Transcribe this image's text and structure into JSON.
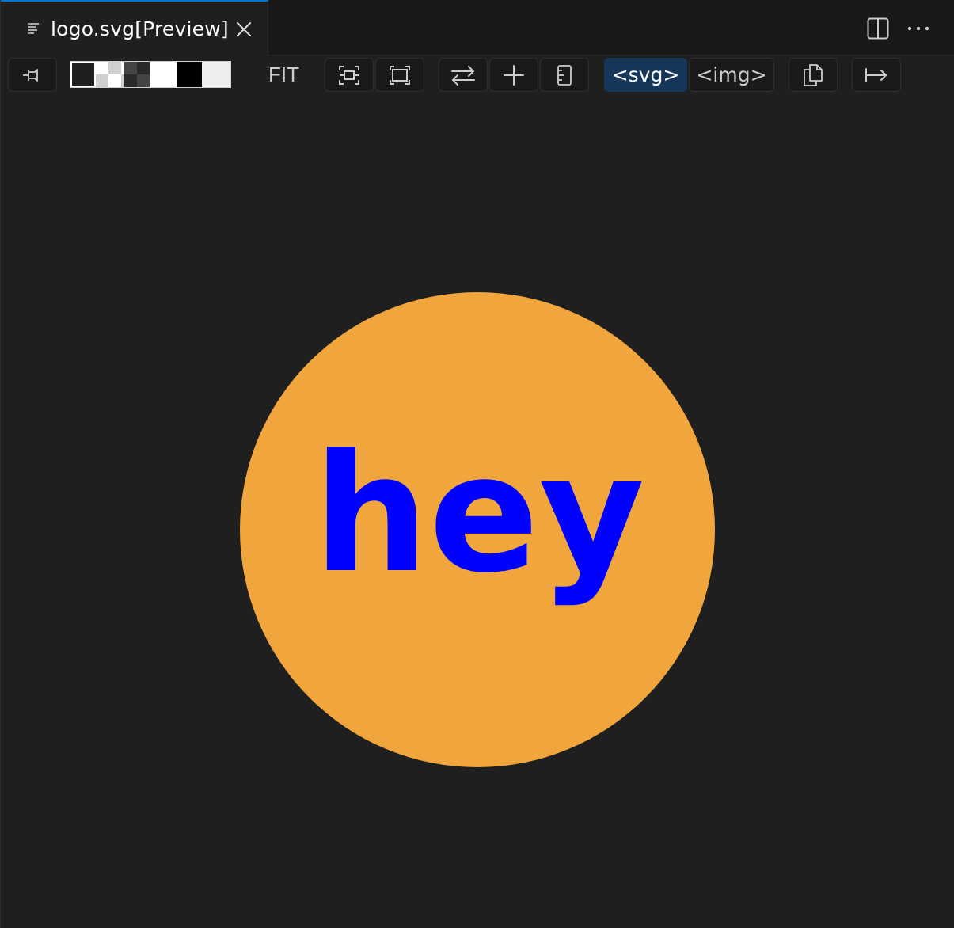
{
  "tab": {
    "title": "logo.svg[Preview]",
    "file_icon": "lines-icon",
    "close_icon": "close-icon"
  },
  "editor_actions": {
    "split_icon": "split-editor-icon",
    "more_icon": "ellipsis-icon"
  },
  "toolbar": {
    "pin_icon": "pin-icon",
    "background_swatches": [
      "dark",
      "checker-light",
      "checker-dark",
      "white",
      "black",
      "light-gray"
    ],
    "fit_label": "FIT",
    "zoom_fit_icon": "fit-frame-icon",
    "zoom_fill_icon": "fill-frame-icon",
    "swap_icon": "swap-arrows-icon",
    "add_icon": "plus-icon",
    "ruler_icon": "ruler-icon",
    "mode_svg_label": "<svg>",
    "mode_img_label": "<img>",
    "active_mode": "<svg>",
    "copy_icon": "copy-icon",
    "export_icon": "arrow-right-bar-icon"
  },
  "preview": {
    "text": "hey",
    "circle_color": "#F0A63C",
    "text_color": "#0000FF",
    "background_color": "#1F1F1F"
  },
  "colors": {
    "accent": "#0078D4",
    "active_mode_bg": "#17375A"
  }
}
